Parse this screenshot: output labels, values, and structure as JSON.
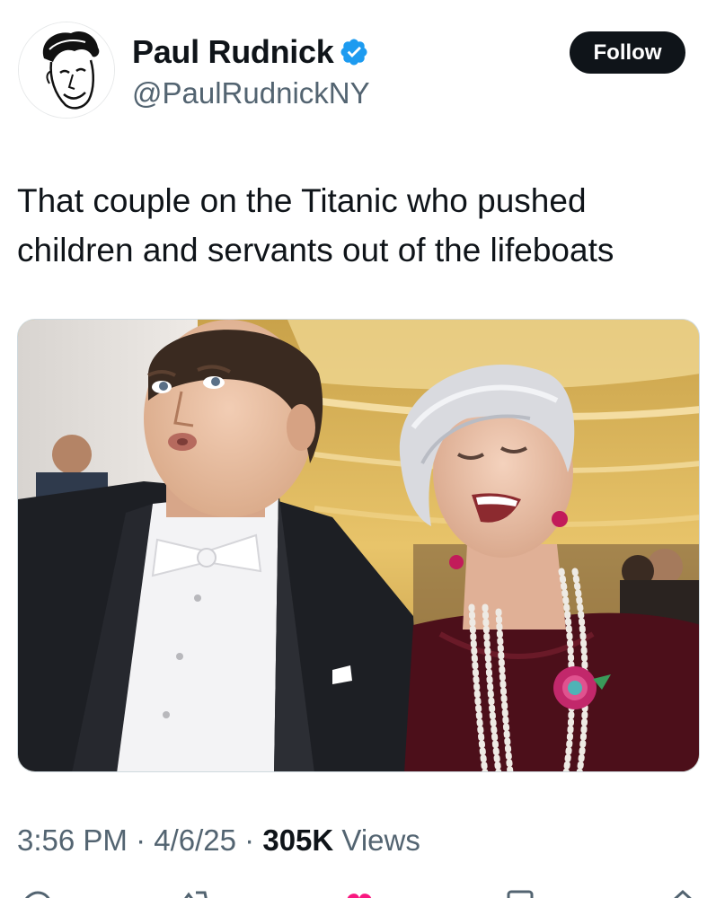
{
  "author": {
    "display_name": "Paul Rudnick",
    "handle": "@PaulRudnickNY",
    "verified": true,
    "avatar_icon": "caricature-avatar-icon",
    "verified_icon": "verified-badge-icon",
    "verified_color": "#1d9bf0"
  },
  "follow_button": {
    "label": "Follow"
  },
  "tweet": {
    "text": "That couple on the Titanic who pushed children and servants out of the lifeboats"
  },
  "media": {
    "type": "photo"
  },
  "meta": {
    "time": "3:56 PM",
    "separator": "·",
    "date": "4/6/25",
    "views_count": "305K",
    "views_label": "Views"
  },
  "actions": [
    {
      "icon": "reply-icon"
    },
    {
      "icon": "retweet-icon"
    },
    {
      "icon": "like-icon",
      "color": "#f91880"
    },
    {
      "icon": "bookmark-icon"
    },
    {
      "icon": "share-icon"
    }
  ],
  "colors": {
    "text_primary": "#0f1419",
    "text_secondary": "#536471",
    "button_bg": "#0f1419",
    "button_text": "#ffffff"
  }
}
